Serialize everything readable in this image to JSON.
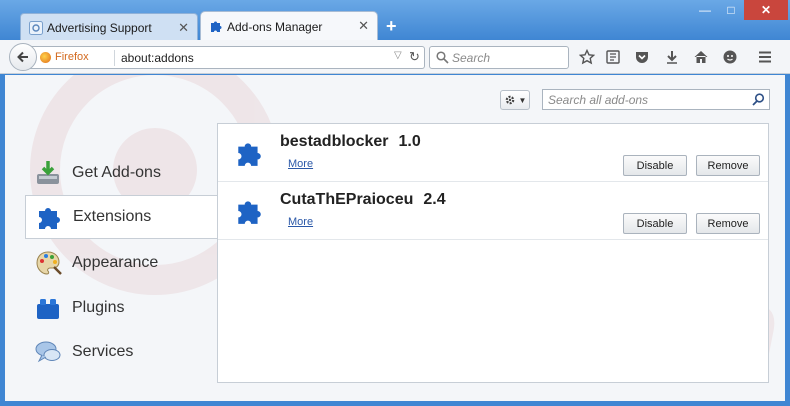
{
  "tabs": [
    {
      "label": "Advertising Support",
      "active": false
    },
    {
      "label": "Add-ons Manager",
      "active": true
    }
  ],
  "window_controls": {
    "minimize": "—",
    "maximize": "□",
    "close": "✕"
  },
  "toolbar": {
    "identity_label": "Firefox",
    "url": "about:addons",
    "search_placeholder": "Search"
  },
  "addons_search_placeholder": "Search all add-ons",
  "categories": [
    {
      "label": "Get Add-ons",
      "icon": "get-addons-icon",
      "selected": false
    },
    {
      "label": "Extensions",
      "icon": "extensions-puzzle-icon",
      "selected": true
    },
    {
      "label": "Appearance",
      "icon": "appearance-palette-icon",
      "selected": false
    },
    {
      "label": "Plugins",
      "icon": "plugins-lego-icon",
      "selected": false
    },
    {
      "label": "Services",
      "icon": "services-chat-icon",
      "selected": false
    }
  ],
  "addons": [
    {
      "name": "bestadblocker",
      "version": "1.0",
      "more": "More",
      "disable": "Disable",
      "remove": "Remove"
    },
    {
      "name": "CutaThEPraioceu",
      "version": "2.4",
      "more": "More",
      "disable": "Disable",
      "remove": "Remove"
    }
  ],
  "colors": {
    "accent": "#3f86d3",
    "link": "#2b58a8",
    "puzzle": "#1e63c4"
  }
}
